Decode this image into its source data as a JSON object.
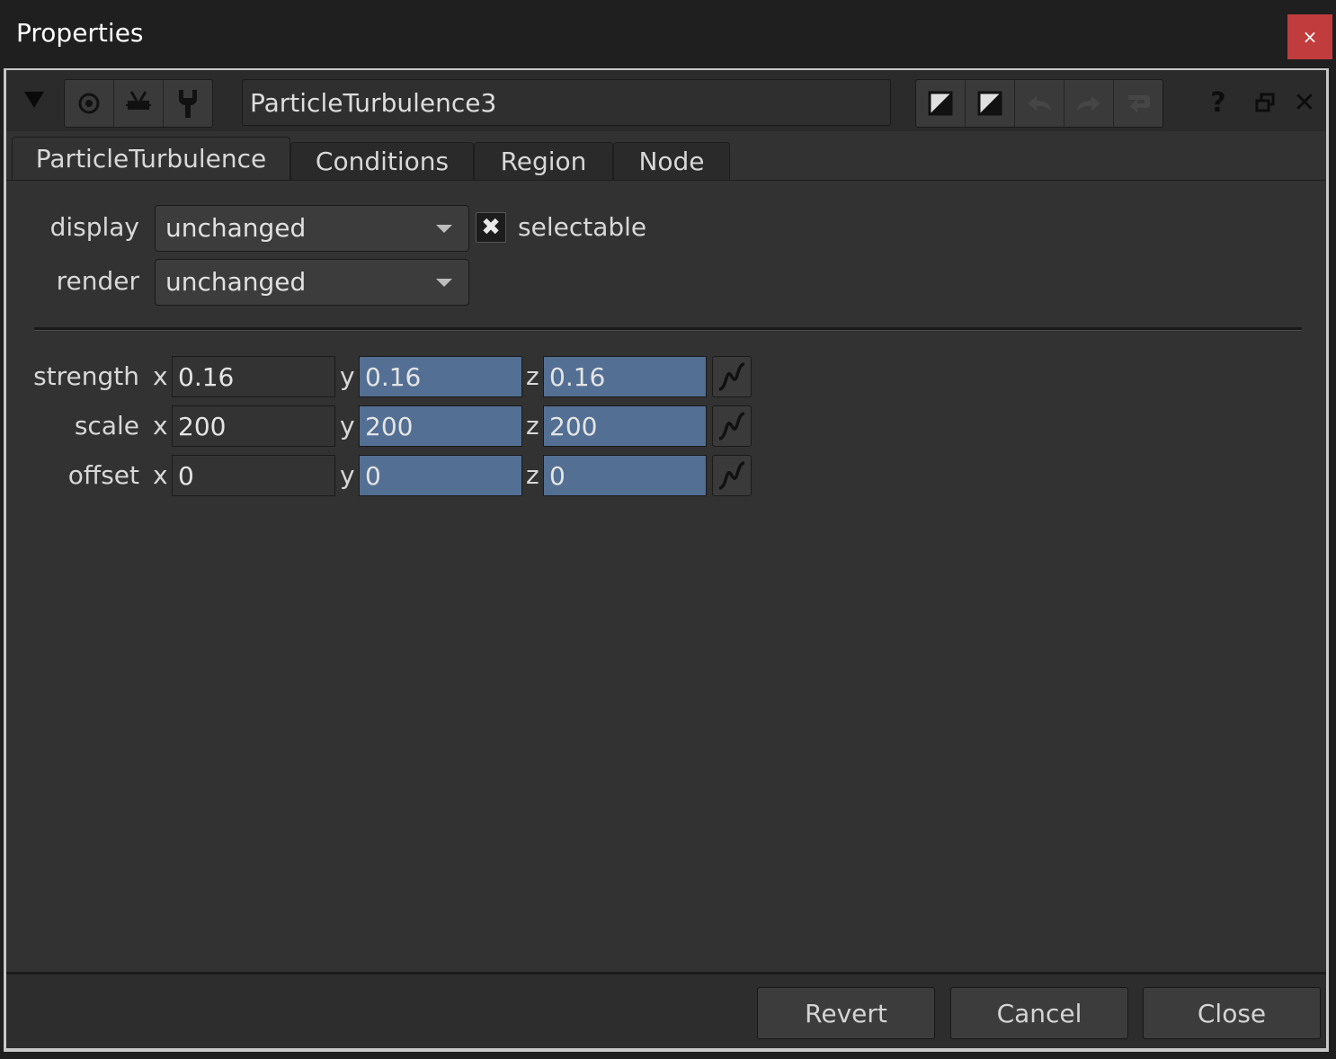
{
  "window": {
    "title": "Properties",
    "close_glyph": "×"
  },
  "toolbar": {
    "node_name": "ParticleTurbulence3",
    "left_icons": [
      "target-icon",
      "antenna-icon",
      "wrench-icon"
    ],
    "right_icons": [
      "value-toggle-icon",
      "value-toggle-icon",
      "undo-icon",
      "redo-icon",
      "revert-icon"
    ],
    "help_glyph": "?",
    "close_glyph": "✕"
  },
  "tabs": [
    {
      "label": "ParticleTurbulence",
      "active": true
    },
    {
      "label": "Conditions",
      "active": false
    },
    {
      "label": "Region",
      "active": false
    },
    {
      "label": "Node",
      "active": false
    }
  ],
  "controls": {
    "display": {
      "label": "display",
      "value": "unchanged"
    },
    "render": {
      "label": "render",
      "value": "unchanged"
    },
    "selectable": {
      "label": "selectable",
      "checked": true,
      "glyph": "✖"
    }
  },
  "vectors": [
    {
      "label": "strength",
      "x": "0.16",
      "y": "0.16",
      "z": "0.16"
    },
    {
      "label": "scale",
      "x": "200",
      "y": "200",
      "z": "200"
    },
    {
      "label": "offset",
      "x": "0",
      "y": "0",
      "z": "0"
    }
  ],
  "axis_labels": {
    "x": "x",
    "y": "y",
    "z": "z"
  },
  "footer": {
    "revert": "Revert",
    "cancel": "Cancel",
    "close": "Close"
  },
  "colors": {
    "linked_field": "#536f93",
    "close_button": "#c13c3c"
  }
}
